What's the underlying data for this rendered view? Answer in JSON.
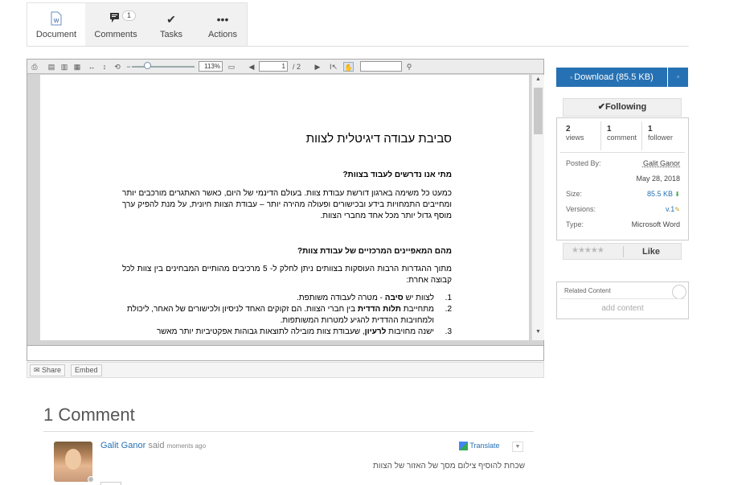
{
  "tabs": [
    {
      "label": "Document",
      "icon": "word-document-icon",
      "active": true
    },
    {
      "label": "Comments",
      "icon": "comments-icon",
      "badge": "1"
    },
    {
      "label": "Tasks",
      "icon": "check-icon"
    },
    {
      "label": "Actions",
      "icon": "more-icon"
    }
  ],
  "viewer": {
    "zoom": "113%",
    "page_value": "1",
    "page_total": "/ 2",
    "search_placeholder": ""
  },
  "doc": {
    "title": "סביבת עבודה דיגיטלית לצוות",
    "h_q1": "מתי אנו נדרשים לעבוד בצוות?",
    "p1": "כמעט כל משימה בארגון דורשת עבודת צוות. בעולם הדינמי של היום, כאשר האתגרים מורכבים יותר ומחייבים התמחויות בידע ובכישורים ופעולה מהירה יותר – עבודת הצוות חיונית, על מנת להפיק ערך מוסף גדול יותר מכל אחד מחברי הצוות.",
    "h_q2": "מהם המאפיינים המרכזיים של עבודת צוות?",
    "p2": "מתוך ההגדרות הרבות העוסקות בצוותים ניתן לחלק ל- 5 מרכיבים מהותיים המבחינים בין צוות לכל קבוצה אחרת:",
    "items": [
      {
        "n": "1.",
        "pre": "לצוות יש ",
        "bold": "סיבה",
        "post": " - מטרה לעבודה משותפת."
      },
      {
        "n": "2.",
        "pre": "מתחייבת ",
        "bold": "תלות הדדית",
        "post": " בין חברי הצוות. הם זקוקים האחד לניסיון ולכישורים של האחר, ליכולת ולמחויבות ההדדית להגיע למטרות המשותפות."
      },
      {
        "n": "3.",
        "pre": "ישנה מחויבות ",
        "bold": "לרעיון",
        "post": ", שעבודת צוות מובילה לתוצאות גבוהות אפקטיביות יותר מאשר"
      }
    ]
  },
  "share": {
    "share_label": "Share",
    "embed_label": "Embed"
  },
  "sidebar": {
    "download_label": "Download (85.5 KB)",
    "following_label": "Following",
    "stats": [
      {
        "value": "2",
        "label": "views"
      },
      {
        "value": "1",
        "label": "comment"
      },
      {
        "value": "1",
        "label": "follower"
      }
    ],
    "posted_by_label": "Posted By:",
    "posted_by": "Galit Ganor",
    "date": "May 28, 2018",
    "size_label": "Size:",
    "size": "85.5 KB",
    "versions_label": "Versions:",
    "version": "v.1",
    "type_label": "Type:",
    "type": "Microsoft Word",
    "like_label": "Like",
    "related_label": "Related Content",
    "add_content_label": "add content"
  },
  "comments": {
    "heading": "1 Comment",
    "author": "Galit Ganor",
    "said": "said",
    "time": "moments ago",
    "translate_label": "Translate",
    "text": "שכחת להוסיף צילום מסך של האזור של הצוות"
  },
  "colors": {
    "accent": "#2671b3"
  }
}
